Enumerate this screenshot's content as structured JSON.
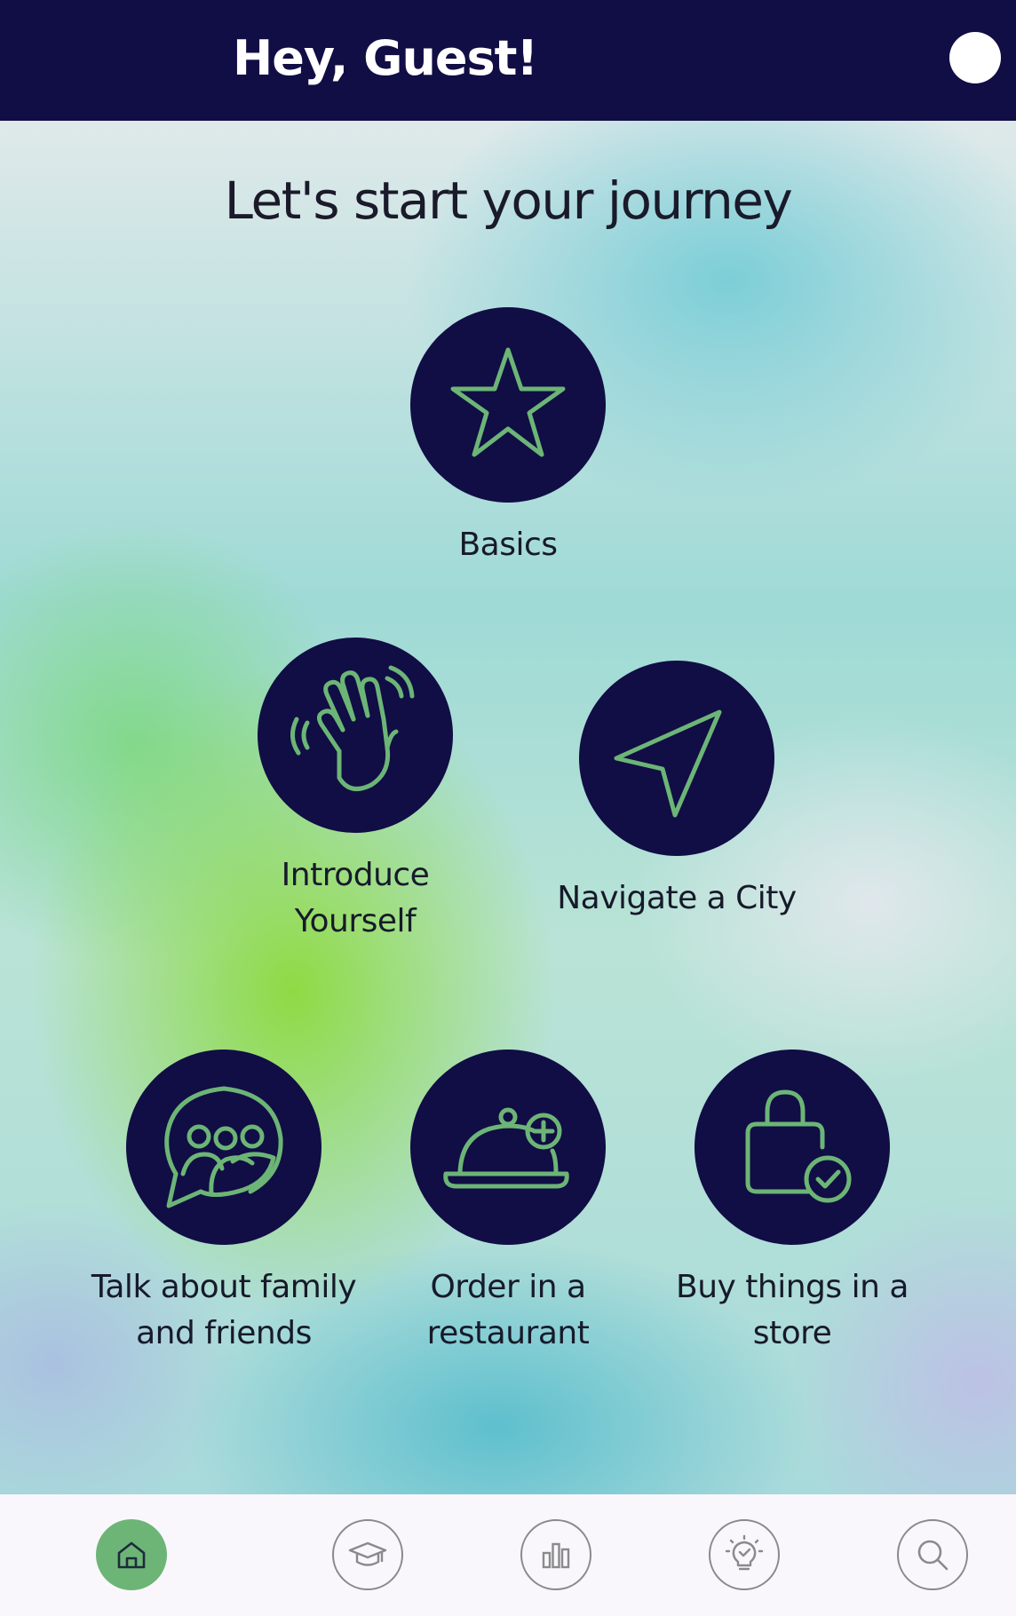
{
  "header": {
    "greeting": "Hey, Guest!",
    "avatar_icon": "avatar-circle"
  },
  "main": {
    "title": "Let's start your journey",
    "topics": [
      {
        "label": "Basics",
        "icon": "star-icon"
      },
      {
        "label": "Introduce Yourself",
        "label_lines": [
          "Introduce",
          "Yourself"
        ],
        "icon": "waving-hand-icon"
      },
      {
        "label": "Navigate a City",
        "icon": "navigation-arrow-icon"
      },
      {
        "label": "Talk about family and friends",
        "label_lines": [
          "Talk about family",
          "and friends"
        ],
        "icon": "group-chat-icon"
      },
      {
        "label": "Order in a restaurant",
        "label_lines": [
          "Order in a",
          "restaurant"
        ],
        "icon": "cloche-icon"
      },
      {
        "label": "Buy things in a store",
        "label_lines": [
          "Buy things in a",
          "store"
        ],
        "icon": "shopping-bag-check-icon"
      }
    ]
  },
  "bottom_nav": {
    "items": [
      {
        "icon": "home-icon",
        "active": true
      },
      {
        "icon": "graduation-cap-icon",
        "active": false
      },
      {
        "icon": "bar-chart-icon",
        "active": false
      },
      {
        "icon": "lightbulb-check-icon",
        "active": false
      },
      {
        "icon": "search-icon",
        "active": false
      }
    ]
  },
  "colors": {
    "navy": "#110d45",
    "icon_green": "#6cb576",
    "nav_active": "#6cb576",
    "text": "#161a2a"
  }
}
